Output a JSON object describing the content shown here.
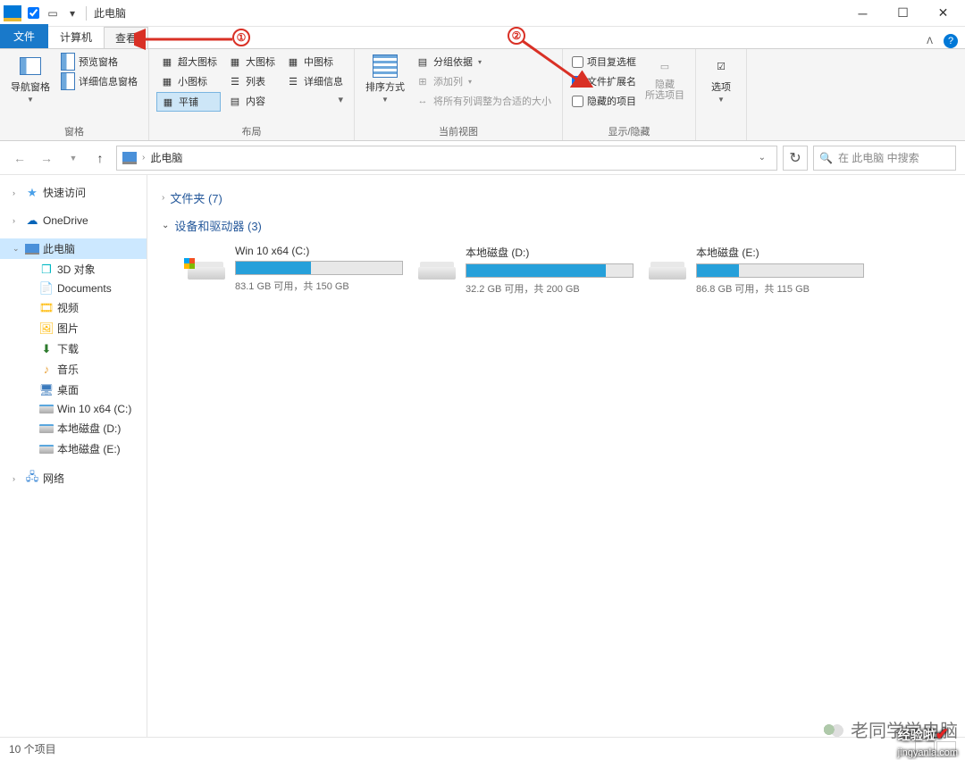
{
  "window": {
    "title": "此电脑"
  },
  "tabs": {
    "file": "文件",
    "computer": "计算机",
    "view": "查看"
  },
  "ribbon": {
    "panes": {
      "nav": "导航窗格",
      "preview": "预览窗格",
      "details": "详细信息窗格",
      "group": "窗格"
    },
    "layout": {
      "xl": "超大图标",
      "lg": "大图标",
      "md": "中图标",
      "sm": "小图标",
      "list": "列表",
      "det": "详细信息",
      "tile": "平铺",
      "content": "内容",
      "group": "布局"
    },
    "view": {
      "sort": "排序方式",
      "groupby": "分组依据",
      "addcol": "添加列",
      "fit": "将所有列调整为合适的大小",
      "group": "当前视图"
    },
    "show": {
      "checkboxes": "项目复选框",
      "ext": "文件扩展名",
      "hidden": "隐藏的项目",
      "hide": "隐藏\n所选项目",
      "group": "显示/隐藏"
    },
    "options": "选项"
  },
  "address": {
    "crumb": "此电脑"
  },
  "search": {
    "placeholder": "在 此电脑 中搜索"
  },
  "tree": {
    "quick": "快速访问",
    "onedrive": "OneDrive",
    "thispc": "此电脑",
    "threed": "3D 对象",
    "docs": "Documents",
    "videos": "视频",
    "pics": "图片",
    "dl": "下载",
    "music": "音乐",
    "desktop": "桌面",
    "c": "Win 10 x64 (C:)",
    "d": "本地磁盘 (D:)",
    "e": "本地磁盘 (E:)",
    "net": "网络"
  },
  "sections": {
    "folders": "文件夹 (7)",
    "drives": "设备和驱动器 (3)"
  },
  "drives": [
    {
      "name": "Win 10 x64 (C:)",
      "free": "83.1 GB 可用，共 150 GB",
      "pct": 45,
      "win": true
    },
    {
      "name": "本地磁盘 (D:)",
      "free": "32.2 GB 可用，共 200 GB",
      "pct": 84,
      "win": false
    },
    {
      "name": "本地磁盘 (E:)",
      "free": "86.8 GB 可用，共 115 GB",
      "pct": 25,
      "win": false
    }
  ],
  "status": {
    "items": "10 个项目"
  },
  "annotations": {
    "n1": "①",
    "n2": "②"
  },
  "watermark": {
    "t1": "老同学学电脑",
    "t2": "经验啦",
    "t3": "jingyanla.com"
  }
}
